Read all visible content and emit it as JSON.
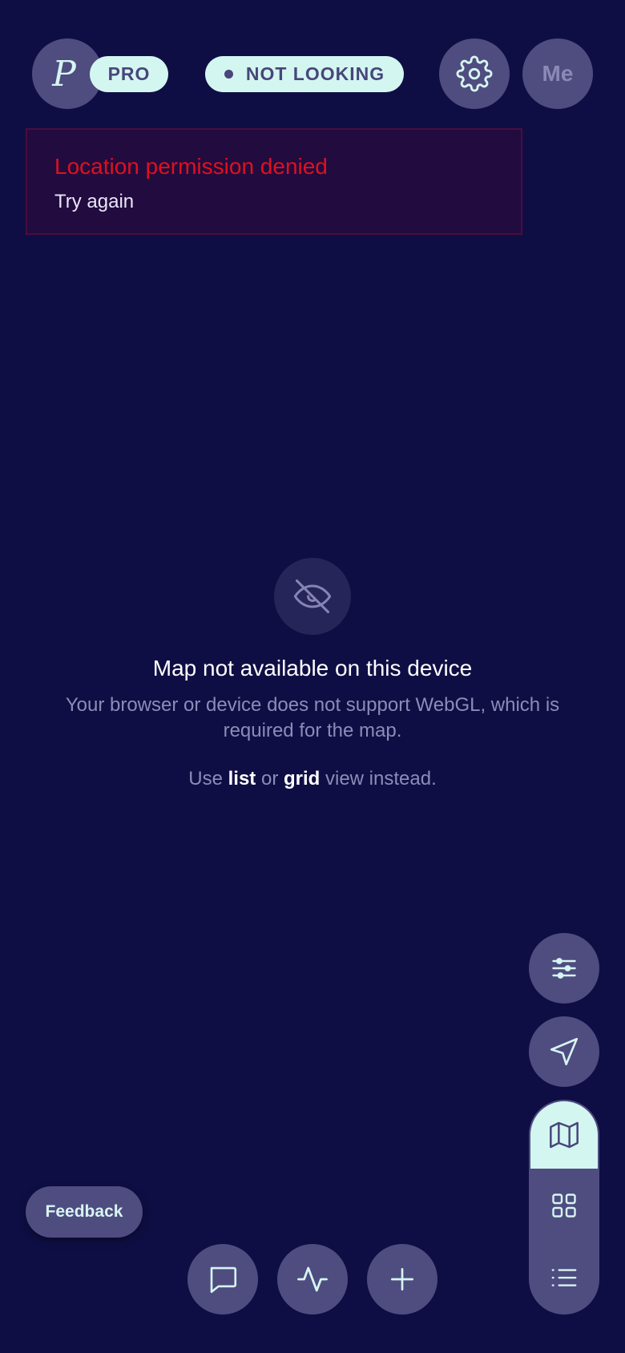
{
  "header": {
    "logo_letter": "P",
    "pro_badge": "PRO",
    "status": "NOT LOOKING",
    "profile_label": "Me"
  },
  "error_banner": {
    "title": "Location permission denied",
    "retry_label": "Try again"
  },
  "map_unavailable": {
    "title": "Map not available on this device",
    "description": "Your browser or device does not support WebGL, which is required for the map.",
    "hint_prefix": "Use ",
    "hint_list": "list",
    "hint_or": " or ",
    "hint_grid": "grid",
    "hint_suffix": " view instead."
  },
  "feedback": {
    "label": "Feedback"
  },
  "view_switch": {
    "selected": "map",
    "options": [
      "map",
      "grid",
      "list"
    ]
  },
  "icons": {
    "settings": "gear-icon",
    "filters": "sliders-icon",
    "locate": "navigation-arrow-icon",
    "map_view": "map-icon",
    "grid_view": "grid-icon",
    "list_view": "list-icon",
    "chat": "chat-bubble-icon",
    "activity": "activity-pulse-icon",
    "add": "plus-icon",
    "map_unavailable": "eye-off-icon"
  },
  "colors": {
    "background": "#0f0e44",
    "button": "#4f4c80",
    "accent": "#d4f6f1",
    "error": "#e0101e",
    "muted_text": "#8d8bb8"
  }
}
